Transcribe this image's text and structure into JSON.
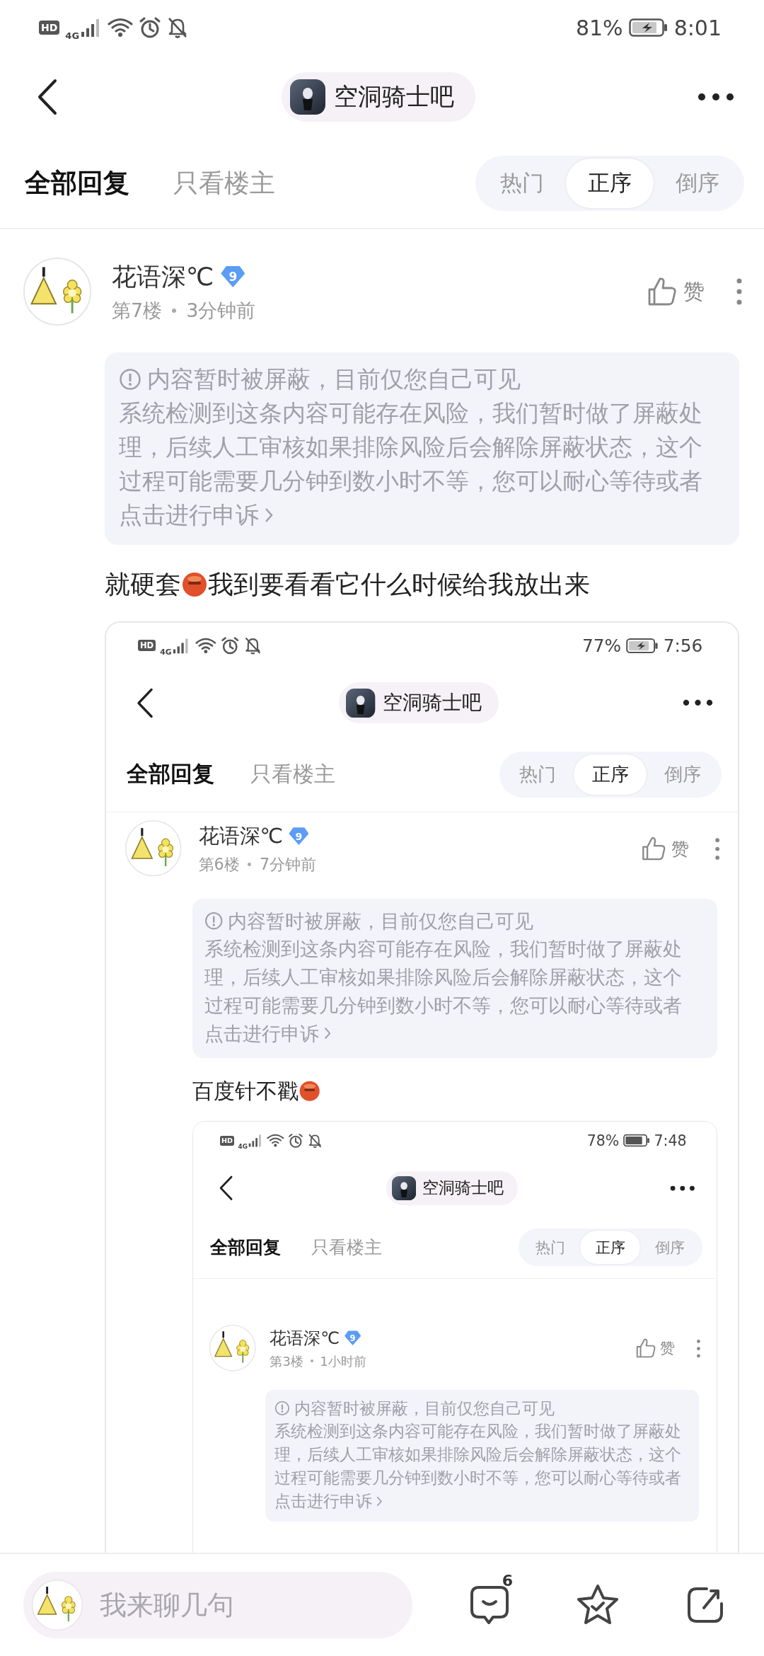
{
  "screen": {
    "status": {
      "hd": "HD",
      "network": "4G",
      "battery_text": "81%",
      "charging": true,
      "time": "8:01"
    },
    "forum": "空洞骑士吧",
    "tabs": [
      {
        "label": "全部回复",
        "selected": true
      },
      {
        "label": "只看楼主",
        "selected": false
      }
    ],
    "sort": [
      {
        "label": "热门",
        "selected": false
      },
      {
        "label": "正序",
        "selected": true
      },
      {
        "label": "倒序",
        "selected": false
      }
    ],
    "posts": [
      {
        "author": "花语深℃",
        "level": "9",
        "floor": "第7楼",
        "time": "3分钟前",
        "like": "赞",
        "notice": {
          "title": "内容暂时被屏蔽，目前仅您自己可见",
          "body": "系统检测到这条内容可能存在风险，我们暂时做了屏蔽处理，后续人工审核如果排除风险后会解除屏蔽状态，这个过程可能需要几分钟到数小时不等，您可以耐心等待或者",
          "link": "点击进行申诉"
        },
        "content": [
          {
            "kind": "text",
            "text": "就硬套"
          },
          {
            "kind": "emoji"
          },
          {
            "kind": "text",
            "text": "我到要看看它什么时候给我放出来"
          }
        ],
        "screenshot": {
          "status": {
            "hd": "HD",
            "network": "4G",
            "battery_text": "77%",
            "charging": true,
            "time": "7:56"
          },
          "forum": "空洞骑士吧",
          "tabs": [
            {
              "label": "全部回复",
              "selected": true
            },
            {
              "label": "只看楼主",
              "selected": false
            }
          ],
          "sort": [
            {
              "label": "热门",
              "selected": false
            },
            {
              "label": "正序",
              "selected": true
            },
            {
              "label": "倒序",
              "selected": false
            }
          ],
          "posts": [
            {
              "author": "花语深℃",
              "level": "9",
              "floor": "第6楼",
              "time": "7分钟前",
              "like": "赞",
              "notice": {
                "title": "内容暂时被屏蔽，目前仅您自己可见",
                "body": "系统检测到这条内容可能存在风险，我们暂时做了屏蔽处理，后续人工审核如果排除风险后会解除屏蔽状态，这个过程可能需要几分钟到数小时不等，您可以耐心等待或者",
                "link": "点击进行申诉"
              },
              "content": [
                {
                  "kind": "text",
                  "text": "百度针不戳"
                },
                {
                  "kind": "emoji"
                }
              ],
              "screenshot": {
                "status": {
                  "hd": "HD",
                  "network": "4G",
                  "battery_text": "78%",
                  "charging": false,
                  "time": "7:48"
                },
                "forum": "空洞骑士吧",
                "tabs": [
                  {
                    "label": "全部回复",
                    "selected": true
                  },
                  {
                    "label": "只看楼主",
                    "selected": false
                  }
                ],
                "sort": [
                  {
                    "label": "热门",
                    "selected": false
                  },
                  {
                    "label": "正序",
                    "selected": true
                  },
                  {
                    "label": "倒序",
                    "selected": false
                  }
                ],
                "posts": [
                  {
                    "author": "花语深℃",
                    "level": "9",
                    "floor": "第3楼",
                    "time": "1小时前",
                    "like": "赞",
                    "notice": {
                      "title": "内容暂时被屏蔽，目前仅您自己可见",
                      "body": "系统检测到这条内容可能存在风险，我们暂时做了屏蔽处理，后续人工审核如果排除风险后会解除屏蔽状态，这个过程可能需要几分钟到数小时不等，您可以耐心等待或者",
                      "link": "点击进行申诉"
                    }
                  }
                ]
              }
            }
          ]
        }
      }
    ]
  },
  "bottom_bar": {
    "placeholder": "我来聊几句",
    "comment_count": "6"
  }
}
